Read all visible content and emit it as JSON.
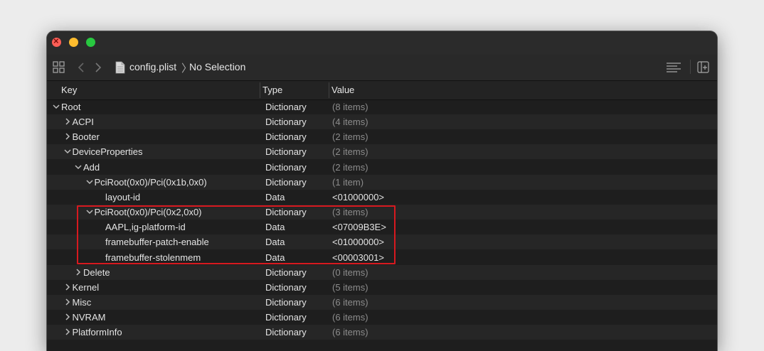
{
  "toolbar": {
    "file_name": "config.plist",
    "separator": "〉",
    "selection": "No Selection"
  },
  "columns": {
    "key": "Key",
    "type": "Type",
    "value": "Value"
  },
  "rows": [
    {
      "key": "Root",
      "type": "Dictionary",
      "value": "(8 items)",
      "depth": 0,
      "expandable": true,
      "expanded": true,
      "dim": true
    },
    {
      "key": "ACPI",
      "type": "Dictionary",
      "value": "(4 items)",
      "depth": 1,
      "expandable": true,
      "expanded": false,
      "dim": true
    },
    {
      "key": "Booter",
      "type": "Dictionary",
      "value": "(2 items)",
      "depth": 1,
      "expandable": true,
      "expanded": false,
      "dim": true
    },
    {
      "key": "DeviceProperties",
      "type": "Dictionary",
      "value": "(2 items)",
      "depth": 1,
      "expandable": true,
      "expanded": true,
      "dim": true
    },
    {
      "key": "Add",
      "type": "Dictionary",
      "value": "(2 items)",
      "depth": 2,
      "expandable": true,
      "expanded": true,
      "dim": true
    },
    {
      "key": "PciRoot(0x0)/Pci(0x1b,0x0)",
      "type": "Dictionary",
      "value": "(1 item)",
      "depth": 3,
      "expandable": true,
      "expanded": true,
      "dim": true
    },
    {
      "key": "layout-id",
      "type": "Data",
      "value": "<01000000>",
      "depth": 4,
      "expandable": false,
      "expanded": false,
      "dim": false
    },
    {
      "key": "PciRoot(0x0)/Pci(0x2,0x0)",
      "type": "Dictionary",
      "value": "(3 items)",
      "depth": 3,
      "expandable": true,
      "expanded": true,
      "dim": true
    },
    {
      "key": "AAPL,ig-platform-id",
      "type": "Data",
      "value": "<07009B3E>",
      "depth": 4,
      "expandable": false,
      "expanded": false,
      "dim": false
    },
    {
      "key": "framebuffer-patch-enable",
      "type": "Data",
      "value": "<01000000>",
      "depth": 4,
      "expandable": false,
      "expanded": false,
      "dim": false
    },
    {
      "key": "framebuffer-stolenmem",
      "type": "Data",
      "value": "<00003001>",
      "depth": 4,
      "expandable": false,
      "expanded": false,
      "dim": false
    },
    {
      "key": "Delete",
      "type": "Dictionary",
      "value": "(0 items)",
      "depth": 2,
      "expandable": true,
      "expanded": false,
      "dim": true
    },
    {
      "key": "Kernel",
      "type": "Dictionary",
      "value": "(5 items)",
      "depth": 1,
      "expandable": true,
      "expanded": false,
      "dim": true
    },
    {
      "key": "Misc",
      "type": "Dictionary",
      "value": "(6 items)",
      "depth": 1,
      "expandable": true,
      "expanded": false,
      "dim": true
    },
    {
      "key": "NVRAM",
      "type": "Dictionary",
      "value": "(6 items)",
      "depth": 1,
      "expandable": true,
      "expanded": false,
      "dim": true
    },
    {
      "key": "PlatformInfo",
      "type": "Dictionary",
      "value": "(6 items)",
      "depth": 1,
      "expandable": true,
      "expanded": false,
      "dim": true
    }
  ],
  "colors": {
    "highlight": "#d7191f",
    "background": "#1e1e1e"
  },
  "icons": [
    "grid-icon",
    "back-chevron-icon",
    "forward-chevron-icon",
    "document-icon",
    "list-lines-icon",
    "add-inspector-icon"
  ]
}
